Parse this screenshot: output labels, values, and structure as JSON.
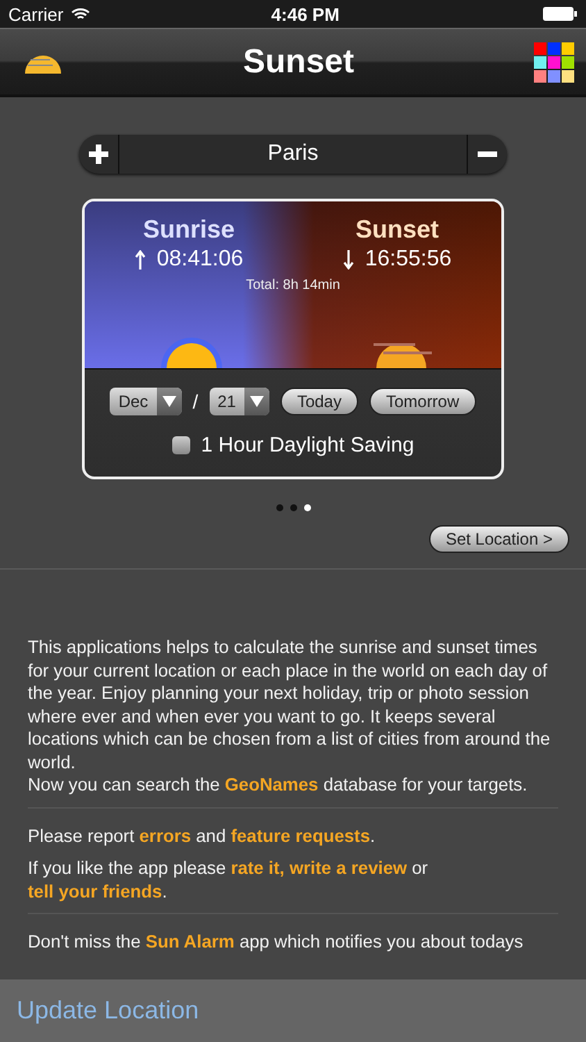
{
  "status_bar": {
    "carrier": "Carrier",
    "time": "4:46 PM"
  },
  "nav_bar": {
    "title": "Sunset"
  },
  "location": {
    "city": "Paris"
  },
  "sun_card": {
    "sunrise": {
      "label": "Sunrise",
      "time": "08:41:06"
    },
    "sunset": {
      "label": "Sunset",
      "time": "16:55:56"
    },
    "total": "Total: 8h 14min",
    "month": "Dec",
    "separator": "/",
    "day": "21",
    "buttons": [
      "Today",
      "Tomorrow"
    ],
    "daylight_saving": {
      "label": "1 Hour Daylight Saving",
      "checked": false
    }
  },
  "page_dots": [
    {
      "selected": false
    },
    {
      "selected": false
    },
    {
      "selected": true
    }
  ],
  "set_location_button": "Set Location >",
  "info": [
    {
      "kind": "text",
      "segments": [
        {
          "text": "This applications helps to calculate the sunrise and sunset times for your current location or each place in the world on each day of the year. Enjoy planning your next holiday, trip or photo session where ever and when ever you want to go. It keeps several locations which can be chosen from a list of cities from around the world.",
          "link": false
        }
      ]
    },
    {
      "kind": "text",
      "segments": [
        {
          "text": "Now you can search the ",
          "link": false
        },
        {
          "text": "GeoNames",
          "link": true
        },
        {
          "text": " database for your targets.",
          "link": false
        }
      ]
    },
    {
      "kind": "divider"
    },
    {
      "kind": "text",
      "segments": [
        {
          "text": "Please report ",
          "link": false
        },
        {
          "text": "errors",
          "link": true
        },
        {
          "text": " and ",
          "link": false
        },
        {
          "text": "feature requests",
          "link": true
        },
        {
          "text": ".",
          "link": false
        }
      ]
    },
    {
      "kind": "text",
      "segments": [
        {
          "text": "If you like the app please ",
          "link": false
        },
        {
          "text": "rate it, write a review",
          "link": true
        },
        {
          "text": " or ",
          "link": false
        },
        {
          "text": "tell your friends",
          "link": true
        },
        {
          "text": ".",
          "link": false
        }
      ]
    },
    {
      "kind": "divider"
    },
    {
      "kind": "text",
      "segments": [
        {
          "text": "Don't miss the ",
          "link": false
        },
        {
          "text": "Sun Alarm",
          "link": true
        },
        {
          "text": " app which notifies you about todays",
          "link": false
        }
      ]
    }
  ],
  "toolbar": {
    "button": "Update Location"
  }
}
